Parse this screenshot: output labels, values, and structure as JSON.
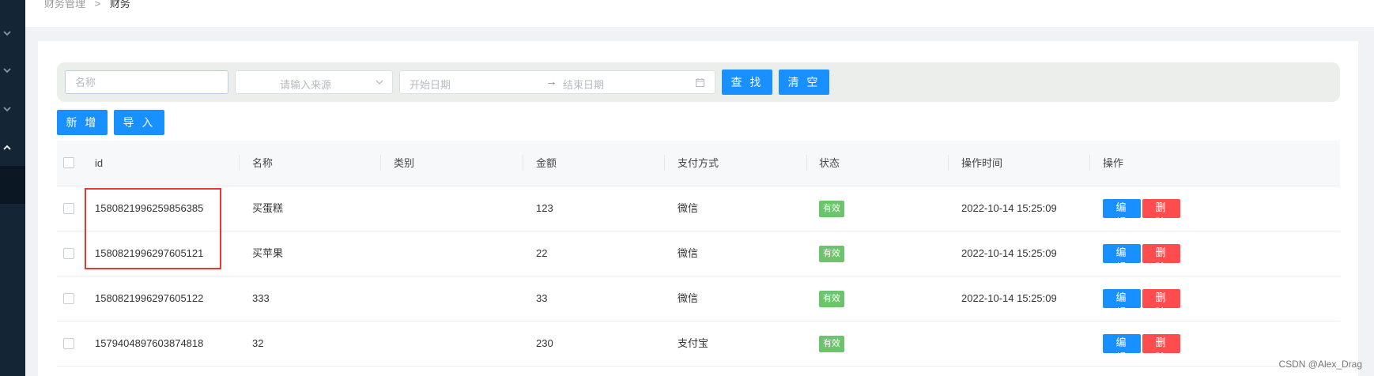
{
  "breadcrumb": {
    "parent": "财务管理",
    "separator": ">",
    "current": "财务"
  },
  "search": {
    "name_placeholder": "名称",
    "source_placeholder": "请输入来源",
    "start_date_placeholder": "开始日期",
    "date_separator": "→",
    "end_date_placeholder": "结束日期",
    "search_label": "查 找",
    "clear_label": "清 空"
  },
  "toolbar": {
    "add_label": "新 增",
    "import_label": "导 入"
  },
  "table": {
    "columns": [
      "id",
      "名称",
      "类别",
      "金额",
      "支付方式",
      "状态",
      "操作时间",
      "操作"
    ],
    "rows": [
      {
        "id": "1580821996259856385",
        "name": "买蛋糕",
        "category": "",
        "amount": "123",
        "payment": "微信",
        "status": "有效",
        "time": "2022-10-14 15:25:09",
        "edit": "编 辑",
        "delete": "删 除"
      },
      {
        "id": "1580821996297605121",
        "name": "买苹果",
        "category": "",
        "amount": "22",
        "payment": "微信",
        "status": "有效",
        "time": "2022-10-14 15:25:09",
        "edit": "编 辑",
        "delete": "删 除"
      },
      {
        "id": "1580821996297605122",
        "name": "333",
        "category": "",
        "amount": "33",
        "payment": "微信",
        "status": "有效",
        "time": "2022-10-14 15:25:09",
        "edit": "编 辑",
        "delete": "删 除"
      },
      {
        "id": "1579404897603874818",
        "name": "32",
        "category": "",
        "amount": "230",
        "payment": "支付宝",
        "status": "有效",
        "time": "",
        "edit": "编 辑",
        "delete": "删 除"
      }
    ]
  },
  "watermark": "CSDN @Alex_Drag",
  "colors": {
    "primary": "#1890ff",
    "danger": "#ff4d4f",
    "success": "#6cc46c",
    "sidebar": "#142535",
    "highlight": "#e53935"
  },
  "icons": {
    "sidebar": [
      "chevron-down-icon",
      "chevron-down-icon",
      "chevron-down-icon",
      "chevron-up-icon"
    ],
    "source": "chevron-down-icon",
    "date": "calendar-icon"
  }
}
